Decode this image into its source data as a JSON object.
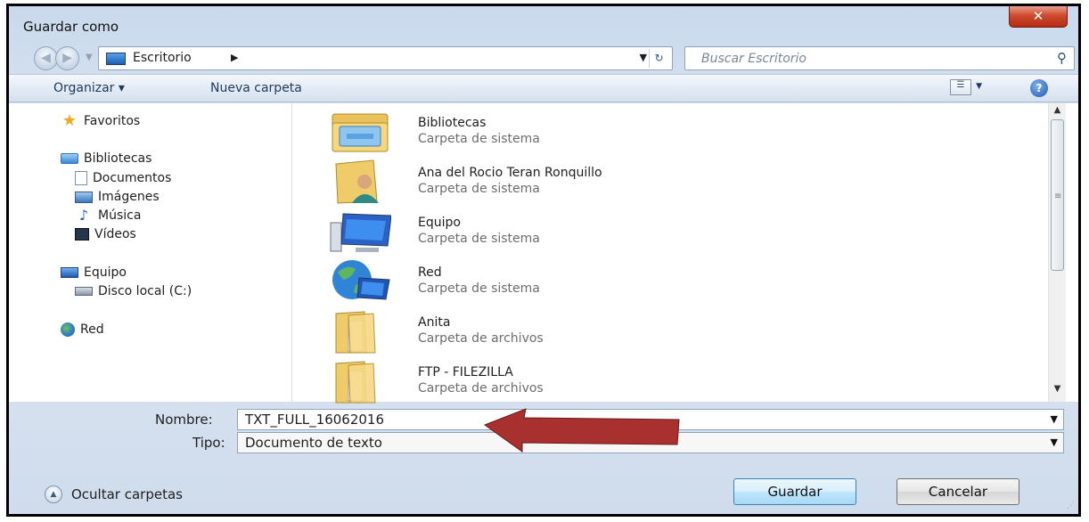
{
  "window": {
    "title": "Guardar como",
    "close_glyph": "✕"
  },
  "address": {
    "location": "Escritorio",
    "search_placeholder": "Buscar Escritorio"
  },
  "toolbar": {
    "organize": "Organizar ▾",
    "new_folder": "Nueva carpeta"
  },
  "sidebar": {
    "favorites": "Favoritos",
    "libraries": "Bibliotecas",
    "documents": "Documentos",
    "images": "Imágenes",
    "music": "Música",
    "videos": "Vídeos",
    "computer": "Equipo",
    "local_disk": "Disco local (C:)",
    "network": "Red"
  },
  "files": [
    {
      "name": "Bibliotecas",
      "type": "Carpeta de sistema",
      "icon": "libraries-folder-icon"
    },
    {
      "name": "Ana del Rocio Teran Ronquillo",
      "type": "Carpeta de sistema",
      "icon": "user-folder-icon"
    },
    {
      "name": "Equipo",
      "type": "Carpeta de sistema",
      "icon": "computer-icon"
    },
    {
      "name": "Red",
      "type": "Carpeta de sistema",
      "icon": "network-icon"
    },
    {
      "name": "Anita",
      "type": "Carpeta de archivos",
      "icon": "folder-icon"
    },
    {
      "name": "FTP - FILEZILLA",
      "type": "Carpeta de archivos",
      "icon": "folder-icon"
    }
  ],
  "form": {
    "name_label": "Nombre:",
    "name_value": "TXT_FULL_16062016",
    "type_label": "Tipo:",
    "type_value": "Documento de texto"
  },
  "footer": {
    "hide_folders": "Ocultar carpetas",
    "save": "Guardar",
    "cancel": "Cancelar"
  },
  "colors": {
    "arrow": "#a8302f",
    "accent": "#3c7fb1"
  }
}
